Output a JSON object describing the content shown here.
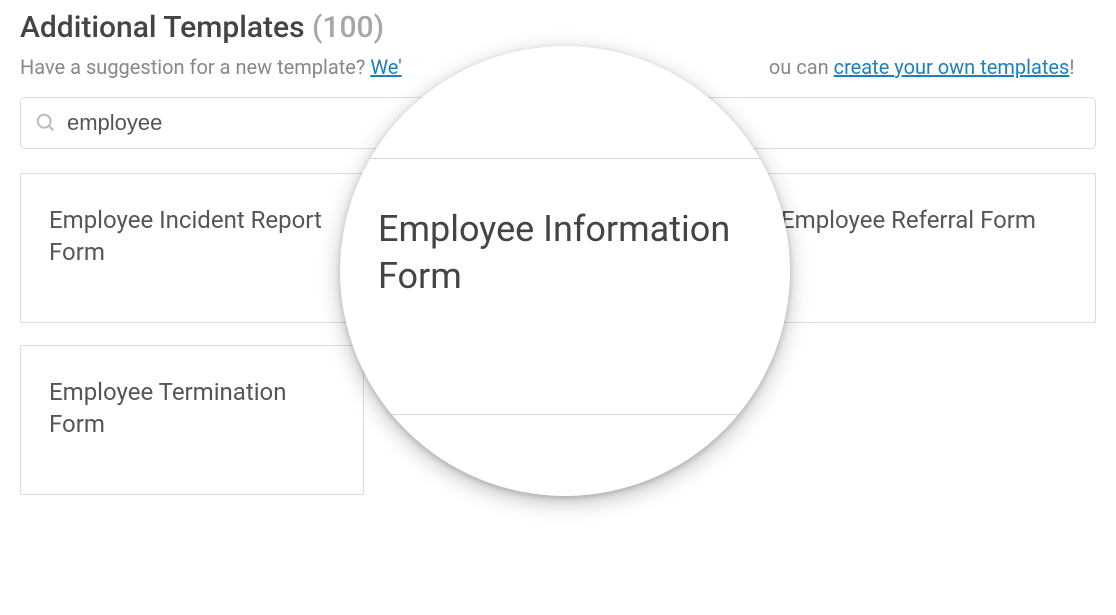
{
  "header": {
    "title": "Additional Templates",
    "count": "(100)"
  },
  "subtitle": {
    "prefix": "Have a suggestion for a new template? ",
    "link1_partial": "We'",
    "midtext": "ou can ",
    "link2": "create your own templates",
    "suffix": "!"
  },
  "search": {
    "value": "employee"
  },
  "templates": [
    {
      "title": "Employee Incident Report Form"
    },
    {
      "title": "Employee Information Form"
    },
    {
      "title": "Employee Referral Form"
    },
    {
      "title": "Employee Termination Form"
    }
  ],
  "magnifier": {
    "featured_title": "Employee Information Form"
  }
}
